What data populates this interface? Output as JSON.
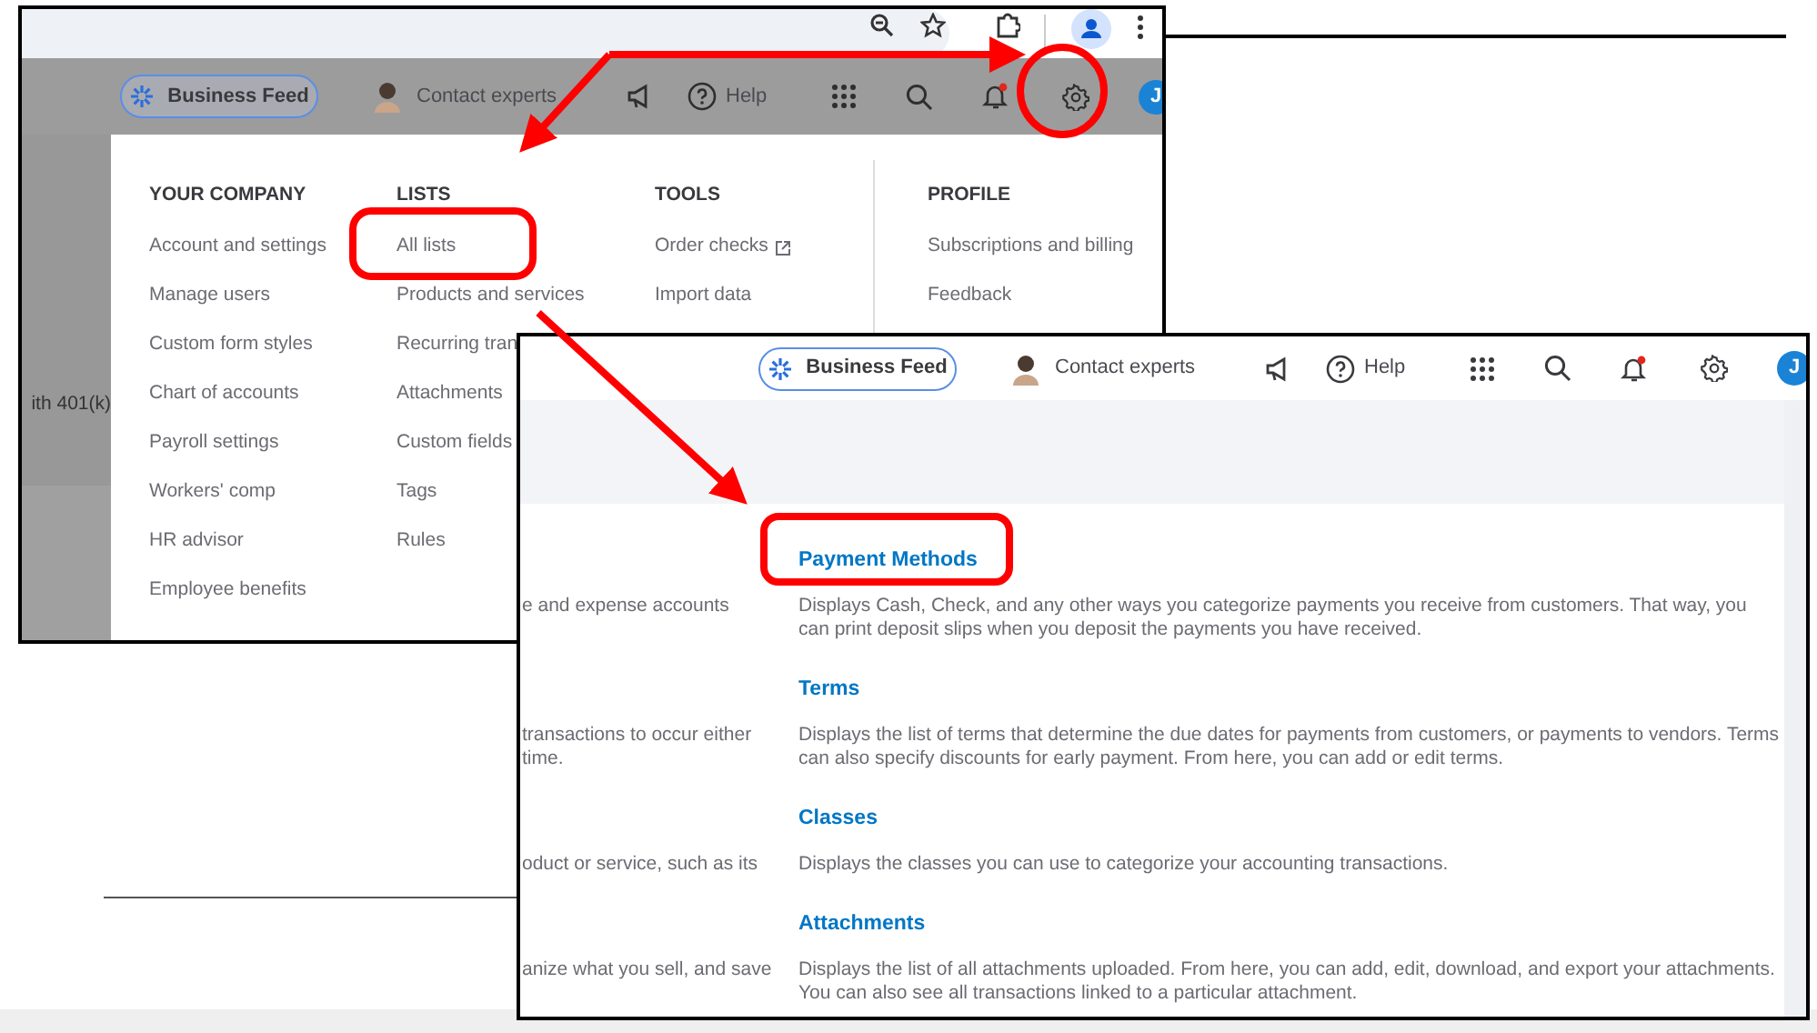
{
  "background_window": {
    "app_header": {
      "business_feed": "Business Feed",
      "contact_experts": "Contact experts",
      "help": "Help",
      "avatar_initial": "J"
    },
    "sidebar_fragment": "ith 401(k)",
    "settings_menu": {
      "columns": [
        {
          "heading": "YOUR COMPANY",
          "items": [
            {
              "label": "Account and settings"
            },
            {
              "label": "Manage users"
            },
            {
              "label": "Custom form styles"
            },
            {
              "label": "Chart of accounts"
            },
            {
              "label": "Payroll settings"
            },
            {
              "label": "Workers' comp"
            },
            {
              "label": "HR advisor"
            },
            {
              "label": "Employee benefits"
            }
          ]
        },
        {
          "heading": "LISTS",
          "items": [
            {
              "label": "All lists"
            },
            {
              "label": "Products and services"
            },
            {
              "label": "Recurring tran"
            },
            {
              "label": "Attachments"
            },
            {
              "label": "Custom fields"
            },
            {
              "label": "Tags"
            },
            {
              "label": "Rules"
            }
          ]
        },
        {
          "heading": "TOOLS",
          "items": [
            {
              "label": "Order checks",
              "external_link": true
            },
            {
              "label": "Import data"
            }
          ]
        },
        {
          "heading": "PROFILE",
          "items": [
            {
              "label": "Subscriptions and billing"
            },
            {
              "label": "Feedback"
            }
          ]
        }
      ]
    }
  },
  "foreground_window": {
    "app_header": {
      "business_feed": "Business Feed",
      "contact_experts": "Contact experts",
      "help": "Help",
      "avatar_initial": "J"
    },
    "lists": [
      {
        "column_1": [
          "e and expense accounts"
        ],
        "title": "Payment Methods",
        "description": "Displays Cash, Check, and any other ways you categorize payments you receive from customers. That way, you can print deposit slips when you deposit the payments you have received."
      },
      {
        "column_1": [
          "transactions to occur either",
          "time."
        ],
        "title": "Terms",
        "description": "Displays the list of terms that determine the due dates for payments from customers, or payments to vendors. Terms can also specify discounts for early payment. From here, you can add or edit terms."
      },
      {
        "column_1": [
          "oduct or service, such as its"
        ],
        "title": "Classes",
        "description": "Displays the classes you can use to categorize your accounting transactions."
      },
      {
        "column_1": [
          "anize what you sell, and save"
        ],
        "title": "Attachments",
        "description": "Displays the list of all attachments uploaded. From here, you can add, edit, download, and export your attachments. You can also see all transactions linked to a particular attachment."
      }
    ]
  }
}
